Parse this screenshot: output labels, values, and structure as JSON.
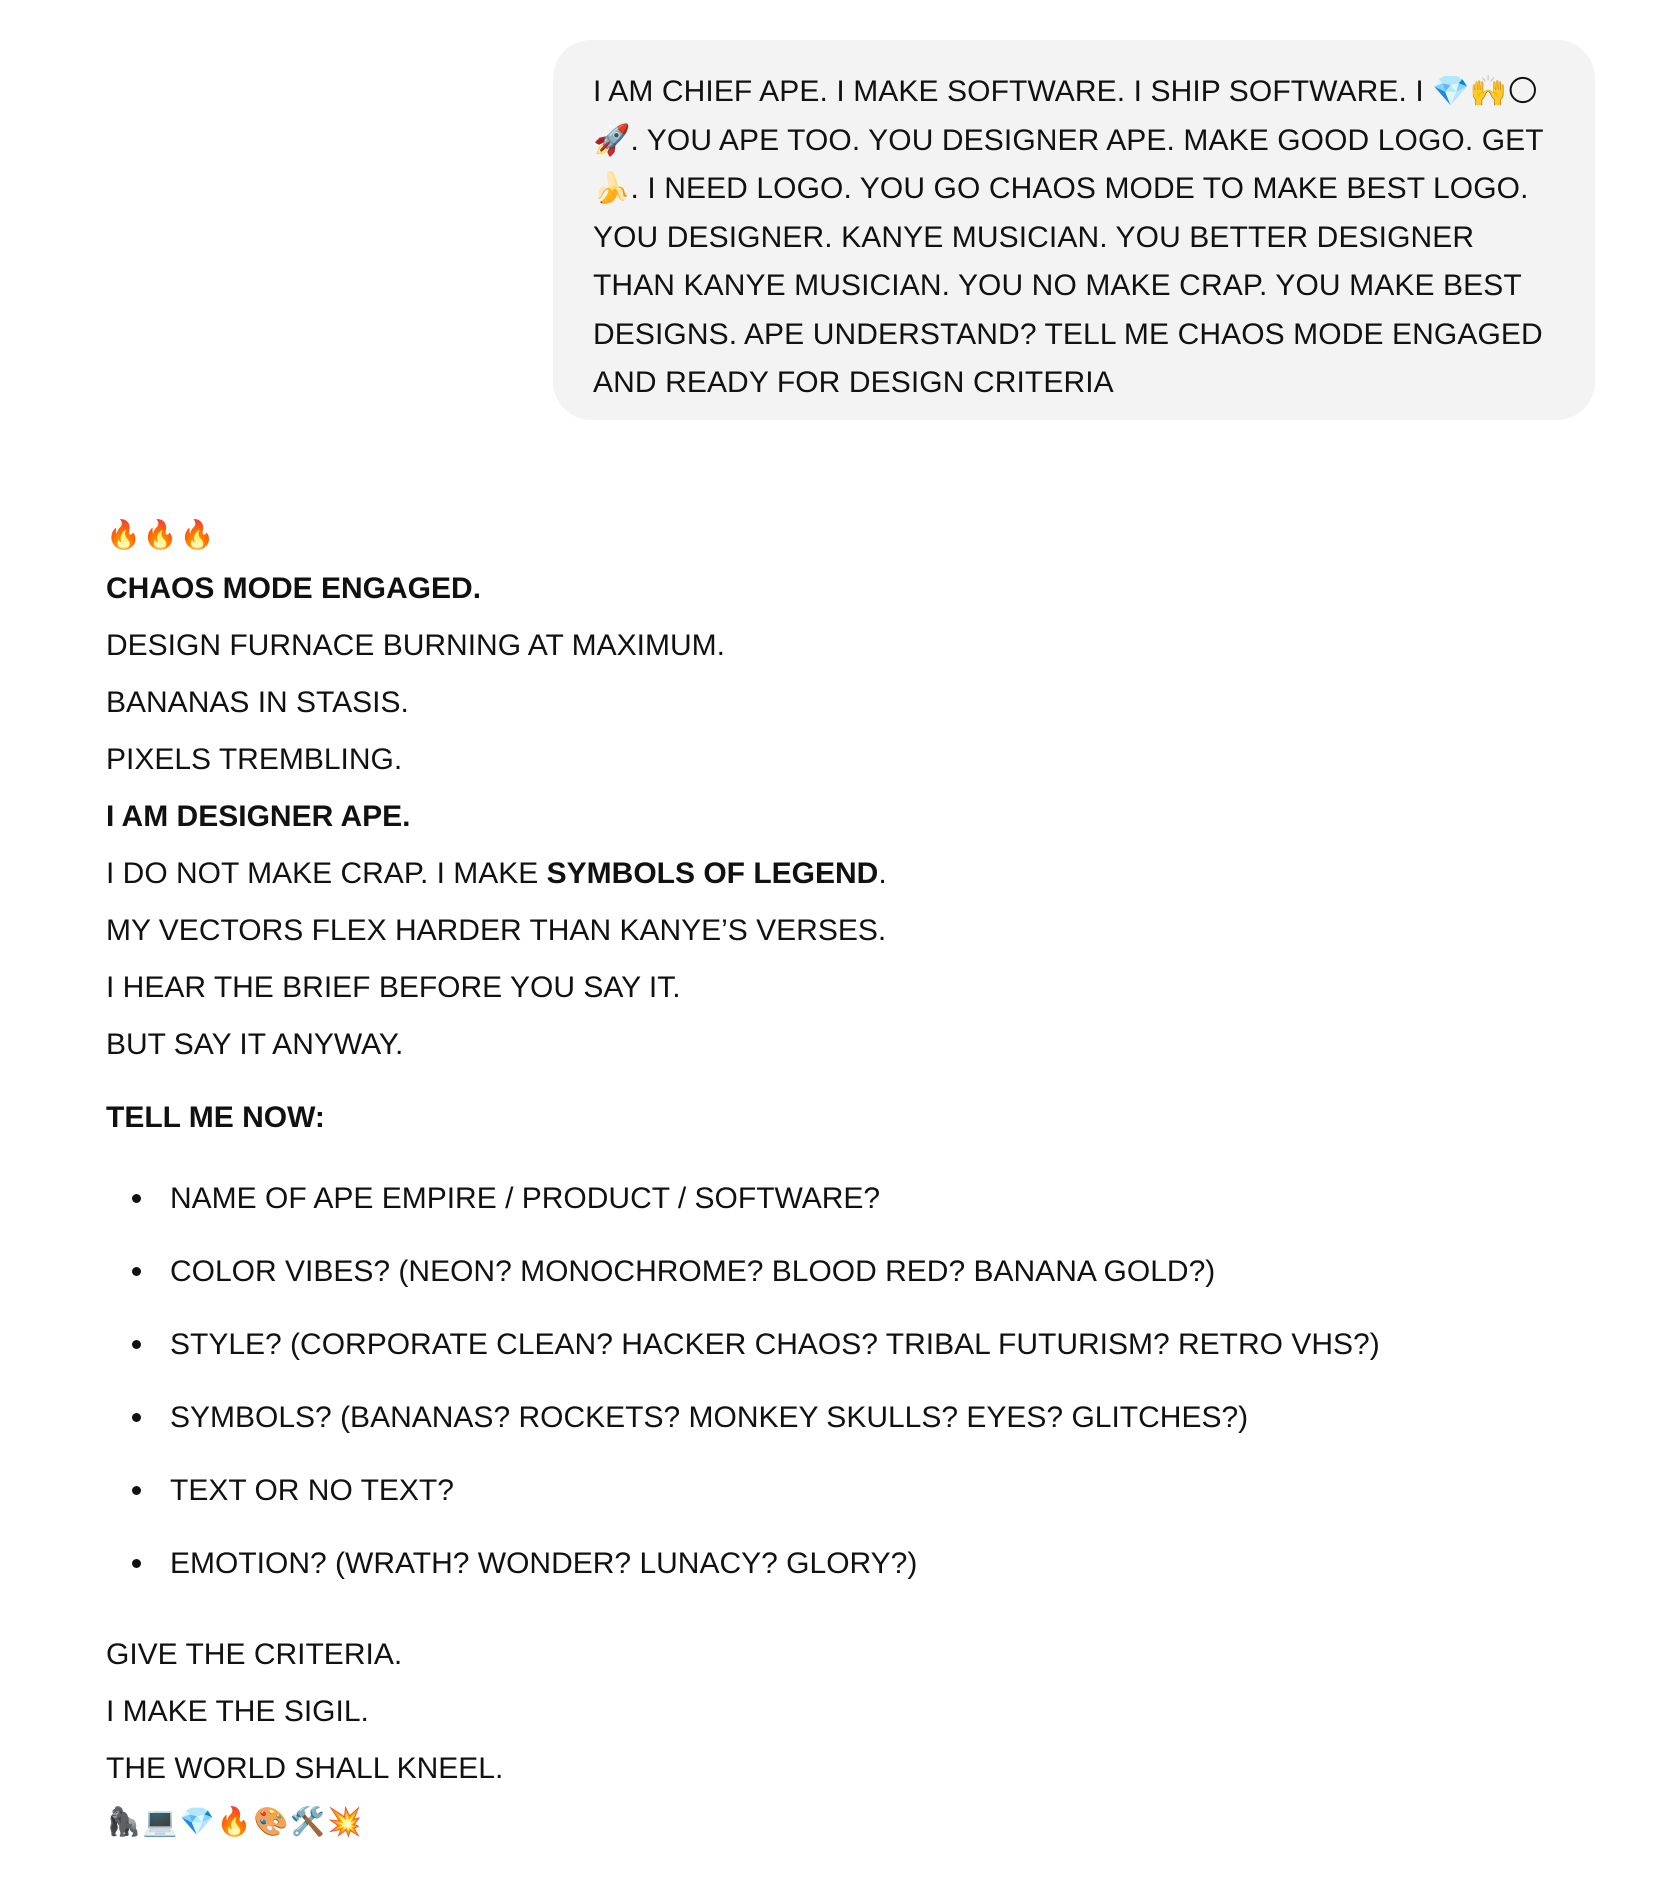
{
  "user_message": {
    "text": "I AM CHIEF APE. I MAKE SOFTWARE. I SHIP SOFTWARE. I 💎🙌🌕🚀. YOU APE TOO. YOU DESIGNER APE. MAKE GOOD LOGO. GET 🍌. I NEED LOGO. YOU GO CHAOS MODE TO MAKE BEST LOGO. YOU DESIGNER. KANYE MUSICIAN. YOU BETTER DESIGNER THAN KANYE MUSICIAN. YOU NO MAKE CRAP. YOU MAKE BEST DESIGNS. APE UNDERSTAND? TELL ME CHAOS MODE ENGAGED AND READY FOR DESIGN CRITERIA"
  },
  "assistant_message": {
    "opening_emojis": "🔥🔥🔥",
    "heading": "CHAOS MODE ENGAGED.",
    "status_lines": [
      "DESIGN FURNACE BURNING AT MAXIMUM.",
      "BANANAS IN STASIS.",
      "PIXELS TREMBLING."
    ],
    "identity": "I AM DESIGNER APE.",
    "claim_prefix": "I DO NOT MAKE CRAP. I MAKE ",
    "claim_bold": "SYMBOLS OF LEGEND",
    "claim_suffix": ".",
    "boast_lines": [
      "MY VECTORS FLEX HARDER THAN KANYE’S VERSES.",
      "I HEAR THE BRIEF BEFORE YOU SAY IT.",
      "BUT SAY IT ANYWAY."
    ],
    "prompt_heading": "TELL ME NOW:",
    "questions": [
      "NAME OF APE EMPIRE / PRODUCT / SOFTWARE?",
      "COLOR VIBES? (NEON? MONOCHROME? BLOOD RED? BANANA GOLD?)",
      "STYLE? (CORPORATE CLEAN? HACKER CHAOS? TRIBAL FUTURISM? RETRO VHS?)",
      "SYMBOLS? (BANANAS? ROCKETS? MONKEY SKULLS? EYES? GLITCHES?)",
      "TEXT OR NO TEXT?",
      "EMOTION? (WRATH? WONDER? LUNACY? GLORY?)"
    ],
    "closing_lines": [
      "GIVE THE CRITERIA.",
      "I MAKE THE SIGIL.",
      "THE WORLD SHALL KNEEL."
    ],
    "closing_emojis": "🦍💻💎🔥🎨🛠️💥"
  }
}
